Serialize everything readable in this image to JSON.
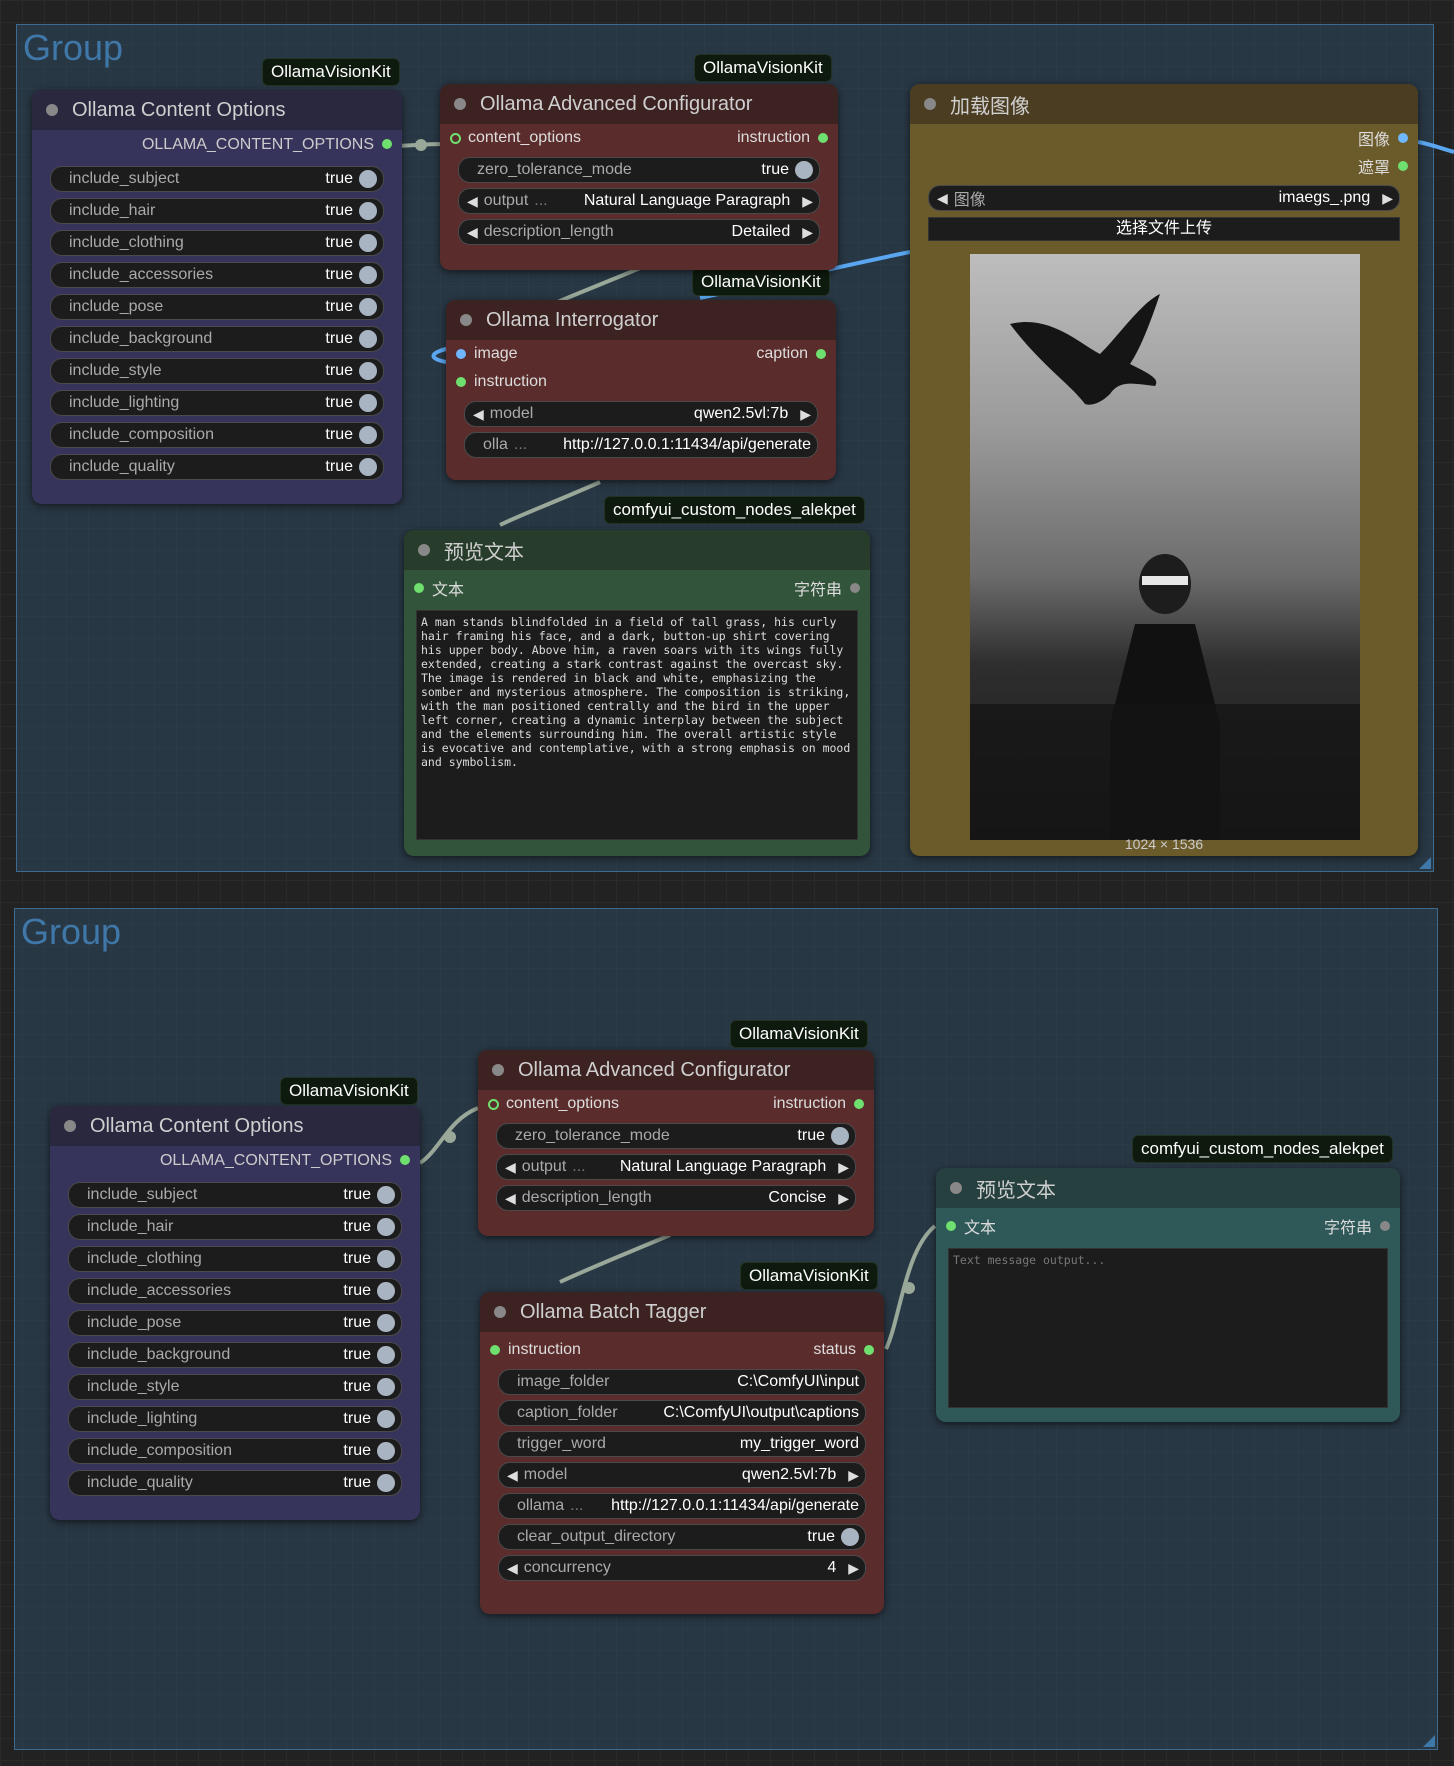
{
  "groups": [
    {
      "title": "Group"
    },
    {
      "title": "Group"
    }
  ],
  "badges": {
    "vision_kit": "OllamaVisionKit",
    "alekpet": "comfyui_custom_nodes_alekpet"
  },
  "content_options_node": {
    "title": "Ollama Content Options",
    "output": "OLLAMA_CONTENT_OPTIONS",
    "widgets": [
      {
        "label": "include_subject",
        "value": "true"
      },
      {
        "label": "include_hair",
        "value": "true"
      },
      {
        "label": "include_clothing",
        "value": "true"
      },
      {
        "label": "include_accessories",
        "value": "true"
      },
      {
        "label": "include_pose",
        "value": "true"
      },
      {
        "label": "include_background",
        "value": "true"
      },
      {
        "label": "include_style",
        "value": "true"
      },
      {
        "label": "include_lighting",
        "value": "true"
      },
      {
        "label": "include_composition",
        "value": "true"
      },
      {
        "label": "include_quality",
        "value": "true"
      }
    ]
  },
  "adv_config_1": {
    "title": "Ollama Advanced Configurator",
    "input": "content_options",
    "output": "instruction",
    "zero_label": "zero_tolerance_mode",
    "zero_value": "true",
    "output_label": "output",
    "output_value": "Natural Language Paragraph",
    "desc_label": "description_length",
    "desc_value": "Detailed"
  },
  "adv_config_2": {
    "title": "Ollama Advanced Configurator",
    "input": "content_options",
    "output": "instruction",
    "zero_label": "zero_tolerance_mode",
    "zero_value": "true",
    "output_label": "output",
    "output_value": "Natural Language Paragraph",
    "desc_label": "description_length",
    "desc_value": "Concise"
  },
  "interrogator": {
    "title": "Ollama Interrogator",
    "in1": "image",
    "in2": "instruction",
    "output": "caption",
    "model_label": "model",
    "model_value": "qwen2.5vl:7b",
    "url_label": "olla",
    "url_value": "http://127.0.0.1:11434/api/generate"
  },
  "load_image": {
    "title": "加载图像",
    "out1": "图像",
    "out2": "遮罩",
    "image_label": "图像",
    "image_value": "imaegs_.png",
    "upload": "选择文件上传",
    "dims": "1024 × 1536"
  },
  "preview_1": {
    "title": "预览文本",
    "input": "文本",
    "output": "字符串",
    "text": "A man stands blindfolded in a field of tall grass, his curly hair framing his face, and a dark, button-up shirt covering his upper body. Above him, a raven soars with its wings fully extended, creating a stark contrast against the overcast sky. The image is rendered in black and white, emphasizing the somber and mysterious atmosphere. The composition is striking, with the man positioned centrally and the bird in the upper left corner, creating a dynamic interplay between the subject and the elements surrounding him. The overall artistic style is evocative and contemplative, with a strong emphasis on mood and symbolism."
  },
  "preview_2": {
    "title": "预览文本",
    "input": "文本",
    "output": "字符串",
    "placeholder": "Text message output..."
  },
  "batch_tagger": {
    "title": "Ollama Batch Tagger",
    "input": "instruction",
    "output": "status",
    "image_folder_label": "image_folder",
    "image_folder_value": "C:\\ComfyUI\\input",
    "caption_folder_label": "caption_folder",
    "caption_folder_value": "C:\\ComfyUI\\output\\captions",
    "trigger_label": "trigger_word",
    "trigger_value": "my_trigger_word",
    "model_label": "model",
    "model_value": "qwen2.5vl:7b",
    "url_label": "ollama",
    "url_value": "http://127.0.0.1:11434/api/generate",
    "clear_label": "clear_output_directory",
    "clear_value": "true",
    "conc_label": "concurrency",
    "conc_value": "4"
  }
}
